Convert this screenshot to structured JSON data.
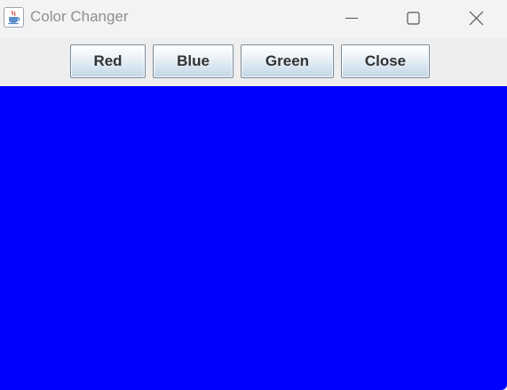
{
  "window": {
    "title": "Color Changer",
    "icon": "java-cup-icon",
    "controls": [
      "minimize-icon",
      "maximize-icon",
      "close-icon"
    ]
  },
  "toolbar": {
    "buttons": [
      {
        "label": "Red"
      },
      {
        "label": "Blue"
      },
      {
        "label": "Green"
      },
      {
        "label": "Close"
      }
    ]
  },
  "canvas": {
    "background_color": "#0000ff"
  }
}
